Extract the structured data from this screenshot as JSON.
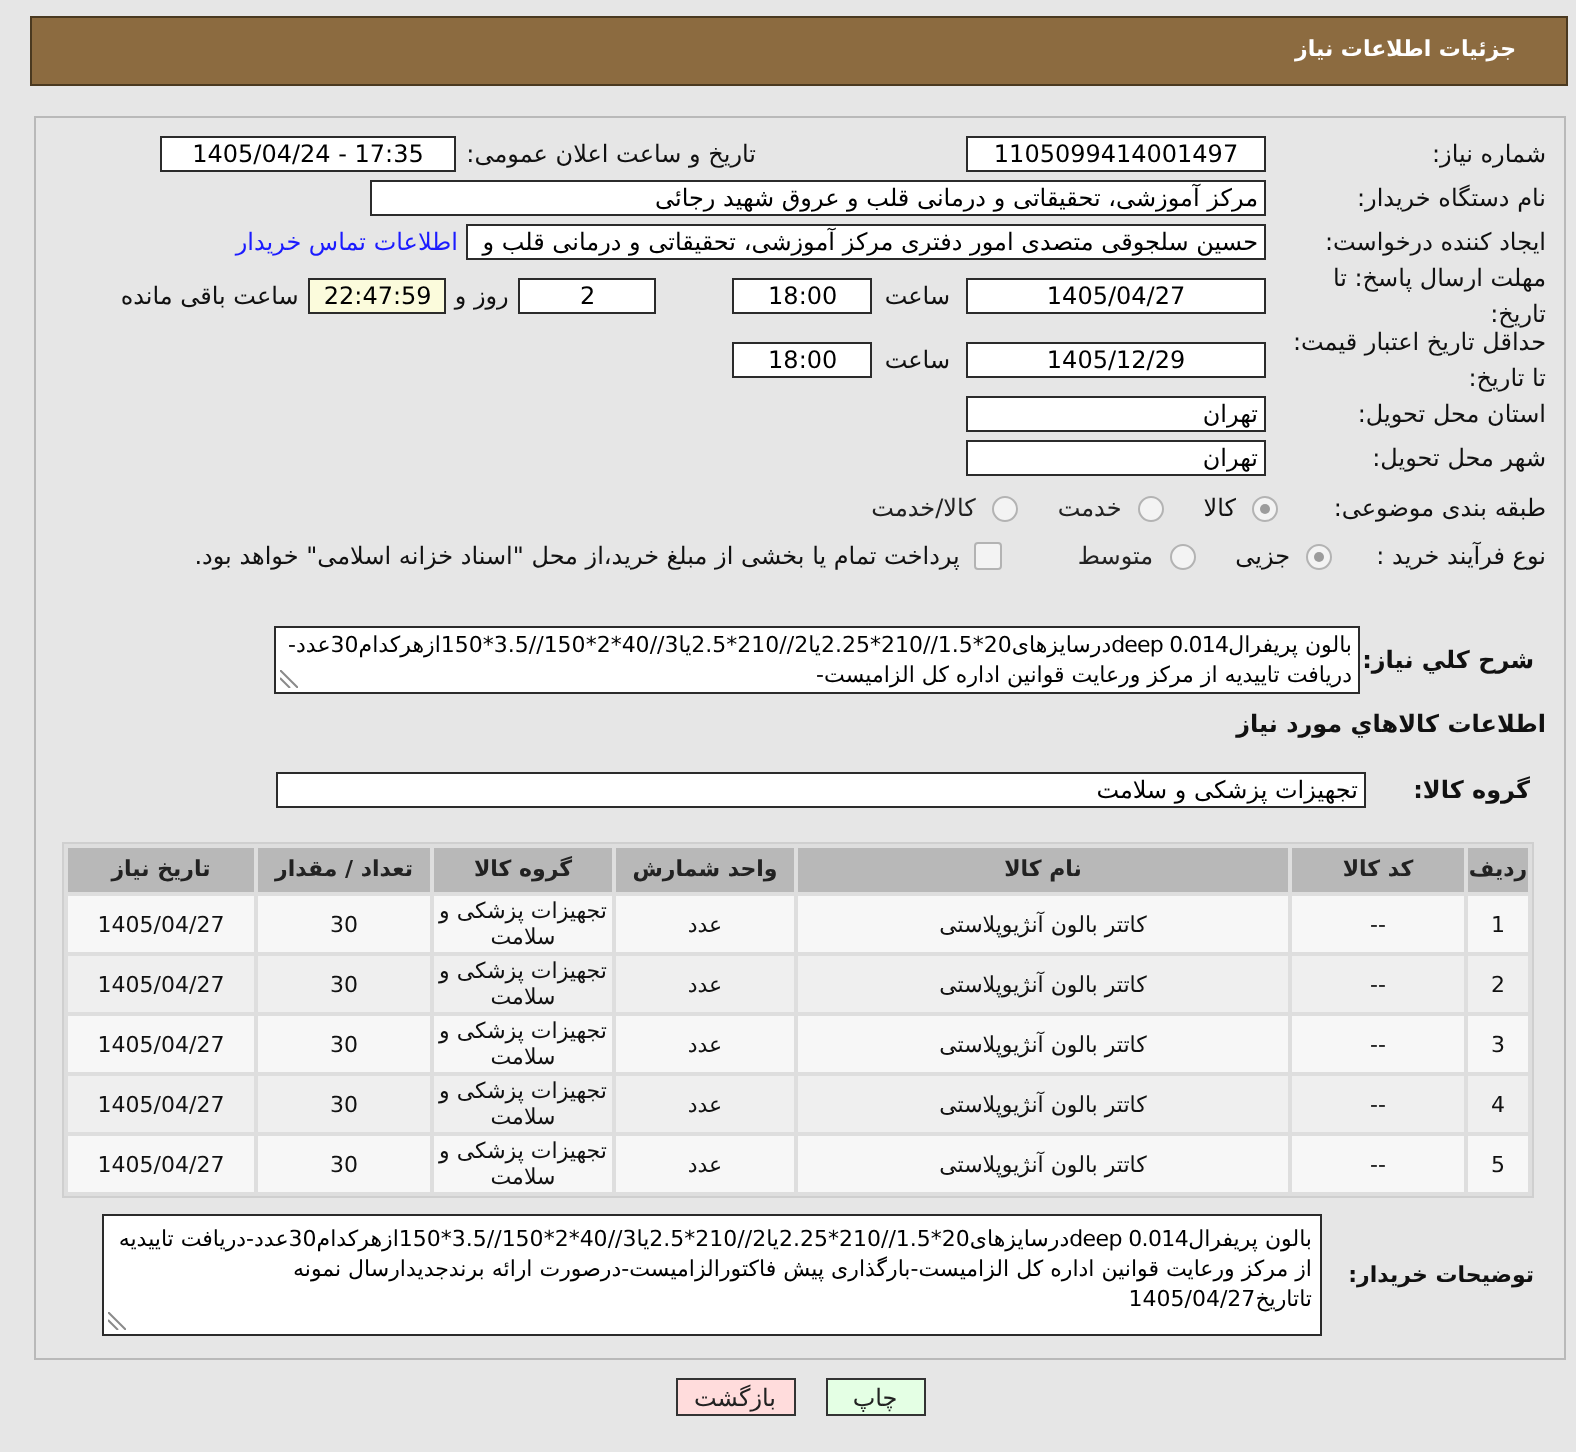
{
  "header": {
    "title": "جزئیات اطلاعات نیاز"
  },
  "form": {
    "need_number": {
      "label": "شماره نیاز:",
      "value": "1105099414001497"
    },
    "announce": {
      "label": "تاریخ و ساعت اعلان عمومی:",
      "value": "1405/04/24 - 17:35"
    },
    "buyer_org": {
      "label": "نام دستگاه خریدار:",
      "value": "مرکز آموزشی، تحقیقاتی و درمانی قلب و عروق شهید رجائی"
    },
    "requester": {
      "label": "ایجاد کننده درخواست:",
      "value": "حسین سلجوقی متصدی امور دفتری مرکز آموزشی، تحقیقاتی و درمانی قلب و",
      "link": "اطلاعات تماس خریدار"
    },
    "deadline": {
      "label": "مهلت ارسال پاسخ: تا تاریخ:",
      "date": "1405/04/27",
      "time_label": "ساعت",
      "time": "18:00",
      "days": "2",
      "days_label": "روز و",
      "remaining": "22:47:59",
      "remaining_label": "ساعت باقی مانده"
    },
    "price_validity": {
      "label": "حداقل تاریخ اعتبار قیمت: تا تاریخ:",
      "date": "1405/12/29",
      "time_label": "ساعت",
      "time": "18:00"
    },
    "province": {
      "label": "استان محل تحویل:",
      "value": "تهران"
    },
    "city": {
      "label": "شهر محل تحویل:",
      "value": "تهران"
    },
    "category": {
      "label": "طبقه بندی موضوعی:",
      "options": [
        {
          "label": "کالا",
          "selected": true
        },
        {
          "label": "خدمت",
          "selected": false
        },
        {
          "label": "کالا/خدمت",
          "selected": false
        }
      ]
    },
    "process": {
      "label": "نوع فرآیند خرید :",
      "options": [
        {
          "label": "جزیی",
          "selected": true
        },
        {
          "label": "متوسط",
          "selected": false
        }
      ],
      "treasury": {
        "label": "پرداخت تمام یا بخشی از مبلغ خرید،از محل \"اسناد خزانه اسلامی\" خواهد بود.",
        "checked": false
      }
    }
  },
  "description": {
    "label": "شرح کلي نیاز:",
    "text": "بالون پریفرالdeep 0.014درسایزهای20*1.5//210*2.25یا2//210*2.5یا3//40*2*150//3.5*150ازهرکدام30عدد-دریافت تاییدیه از مرکز ورعایت قوانین اداره کل الزامیست-"
  },
  "goods": {
    "title": "اطلاعات کالاهاي مورد نیاز",
    "group_label": "گروه کالا:",
    "group": "تجهیزات پزشکی و سلامت",
    "table": {
      "columns": [
        "ردیف",
        "کد کالا",
        "نام کالا",
        "واحد شمارش",
        "گروه کالا",
        "تعداد / مقدار",
        "تاریخ نیاز"
      ],
      "rows": [
        [
          "1",
          "--",
          "کاتتر بالون آنژیوپلاستی",
          "عدد",
          "تجهیزات پزشکی و سلامت",
          "30",
          "1405/04/27"
        ],
        [
          "2",
          "--",
          "کاتتر بالون آنژیوپلاستی",
          "عدد",
          "تجهیزات پزشکی و سلامت",
          "30",
          "1405/04/27"
        ],
        [
          "3",
          "--",
          "کاتتر بالون آنژیوپلاستی",
          "عدد",
          "تجهیزات پزشکی و سلامت",
          "30",
          "1405/04/27"
        ],
        [
          "4",
          "--",
          "کاتتر بالون آنژیوپلاستی",
          "عدد",
          "تجهیزات پزشکی و سلامت",
          "30",
          "1405/04/27"
        ],
        [
          "5",
          "--",
          "کاتتر بالون آنژیوپلاستی",
          "عدد",
          "تجهیزات پزشکی و سلامت",
          "30",
          "1405/04/27"
        ]
      ]
    }
  },
  "buyer_notes": {
    "label": "توضیحات خریدار:",
    "text": "بالون پریفرالdeep 0.014درسایزهای20*1.5//210*2.25یا2//210*2.5یا3//40*2*150//3.5*150ازهرکدام30عدد-دریافت تاییدیه از مرکز ورعایت قوانین اداره کل الزامیست-بارگذاری پیش فاکتورالزامیست-درصورت ارائه برندجدیدارسال نمونه تاتاریخ1405/04/27"
  },
  "buttons": [
    {
      "label": "چاپ",
      "kind": "print"
    },
    {
      "label": "بازگشت",
      "kind": "back"
    }
  ]
}
